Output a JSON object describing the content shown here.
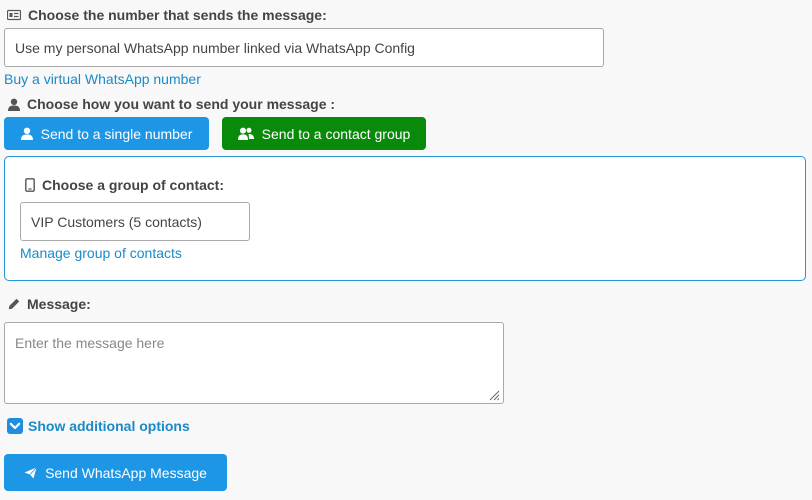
{
  "sender": {
    "label": "Choose the number that sends the message:",
    "icon": "id-card-icon",
    "selected_value": "Use my personal WhatsApp number linked via WhatsApp Config",
    "buy_link": "Buy a virtual WhatsApp number"
  },
  "send_mode": {
    "label": "Choose how you want to send your message :",
    "icon": "user-icon",
    "single_button": "Send to a single number",
    "group_button": "Send to a contact group",
    "colors": {
      "single": "#1e96e6",
      "group": "#0a8a0a"
    }
  },
  "group_panel": {
    "label": "Choose a group of contact:",
    "icon": "mobile-phone-icon",
    "selected_group": "VIP Customers (5 contacts)",
    "manage_link": "Manage group of contacts"
  },
  "message": {
    "label": "Message:",
    "icon": "pencil-icon",
    "placeholder": "Enter the message here",
    "value": ""
  },
  "additional_options": {
    "label": "Show additional options",
    "icon": "chevron-down-icon"
  },
  "submit": {
    "label": "Send WhatsApp Message",
    "icon": "paper-plane-icon"
  },
  "accent_color": "#1a8ac8"
}
